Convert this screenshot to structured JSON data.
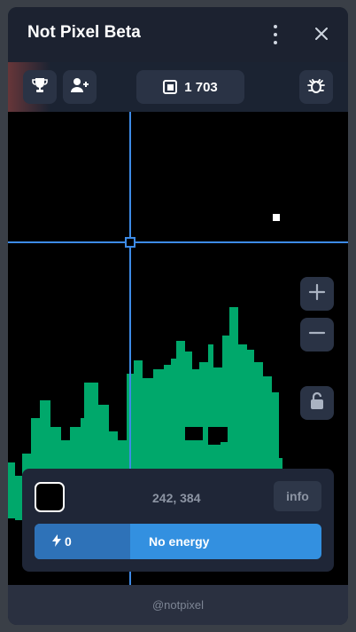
{
  "window": {
    "title": "Not Pixel Beta"
  },
  "toolbar": {
    "pixel_count": "1 703"
  },
  "canvas": {
    "pixel_color": "#00a86b",
    "crosshair_color": "#3d8be6"
  },
  "panel": {
    "selected_color": "#000000",
    "coordinates": "242, 384",
    "info_label": "info",
    "energy_value": "0",
    "energy_status": "No energy"
  },
  "footer": {
    "handle": "@notpixel"
  }
}
